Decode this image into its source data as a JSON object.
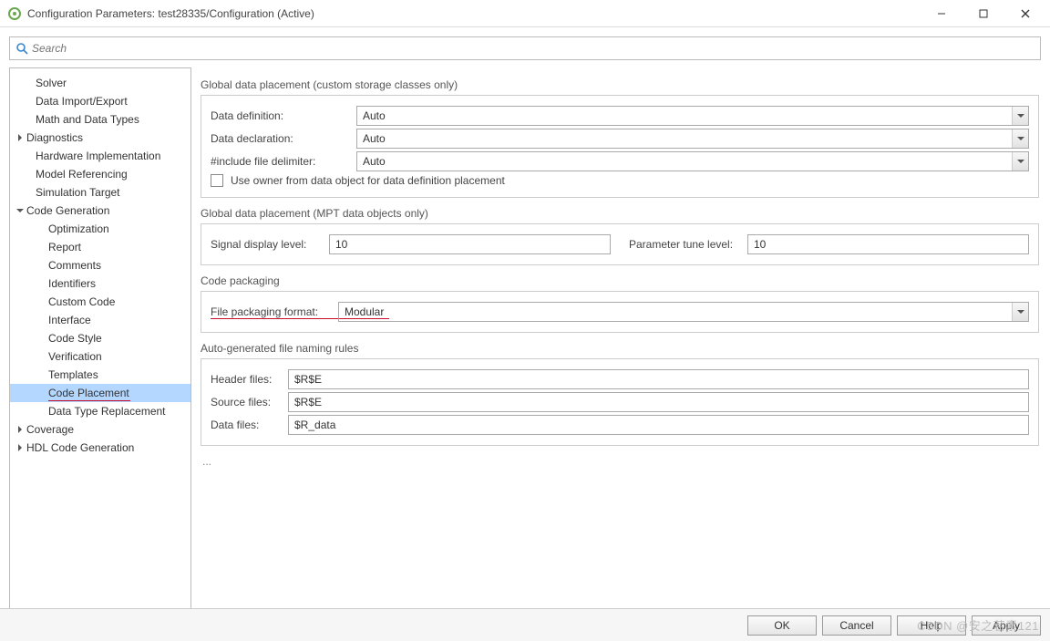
{
  "window": {
    "title": "Configuration Parameters: test28335/Configuration (Active)"
  },
  "search": {
    "placeholder": "Search"
  },
  "sidebar": {
    "items": [
      {
        "label": "Solver",
        "type": "leaf"
      },
      {
        "label": "Data Import/Export",
        "type": "leaf"
      },
      {
        "label": "Math and Data Types",
        "type": "leaf"
      },
      {
        "label": "Diagnostics",
        "type": "parent",
        "expanded": false
      },
      {
        "label": "Hardware Implementation",
        "type": "leaf"
      },
      {
        "label": "Model Referencing",
        "type": "leaf"
      },
      {
        "label": "Simulation Target",
        "type": "leaf"
      },
      {
        "label": "Code Generation",
        "type": "parent",
        "expanded": true
      },
      {
        "label": "Optimization",
        "type": "child"
      },
      {
        "label": "Report",
        "type": "child"
      },
      {
        "label": "Comments",
        "type": "child"
      },
      {
        "label": "Identifiers",
        "type": "child"
      },
      {
        "label": "Custom Code",
        "type": "child"
      },
      {
        "label": "Interface",
        "type": "child"
      },
      {
        "label": "Code Style",
        "type": "child"
      },
      {
        "label": "Verification",
        "type": "child"
      },
      {
        "label": "Templates",
        "type": "child"
      },
      {
        "label": "Code Placement",
        "type": "child",
        "selected": true,
        "redline": true
      },
      {
        "label": "Data Type Replacement",
        "type": "child"
      },
      {
        "label": "Coverage",
        "type": "parent",
        "expanded": false
      },
      {
        "label": "HDL Code Generation",
        "type": "parent",
        "expanded": false
      }
    ]
  },
  "section1": {
    "title": "Global data placement (custom storage classes only)",
    "dataDefLabel": "Data definition:",
    "dataDefValue": "Auto",
    "dataDeclLabel": "Data declaration:",
    "dataDeclValue": "Auto",
    "includeLabel": "#include file delimiter:",
    "includeValue": "Auto",
    "ownerLabel": "Use owner from data object for data definition placement"
  },
  "section2": {
    "title": "Global data placement (MPT data objects only)",
    "sigLabel": "Signal display level:",
    "sigValue": "10",
    "paramLabel": "Parameter tune level:",
    "paramValue": "10"
  },
  "section3": {
    "title": "Code packaging",
    "fpLabel": "File packaging format:",
    "fpValue": "Modular"
  },
  "section4": {
    "title": "Auto-generated file naming rules",
    "hdrLabel": "Header files:",
    "hdrValue": "$R$E",
    "srcLabel": "Source files:",
    "srcValue": "$R$E",
    "datLabel": "Data files:",
    "datValue": "$R_data"
  },
  "footer": {
    "ok": "OK",
    "cancel": "Cancel",
    "help": "Help",
    "apply": "Apply"
  },
  "watermark": "CSDN @安之若素121"
}
